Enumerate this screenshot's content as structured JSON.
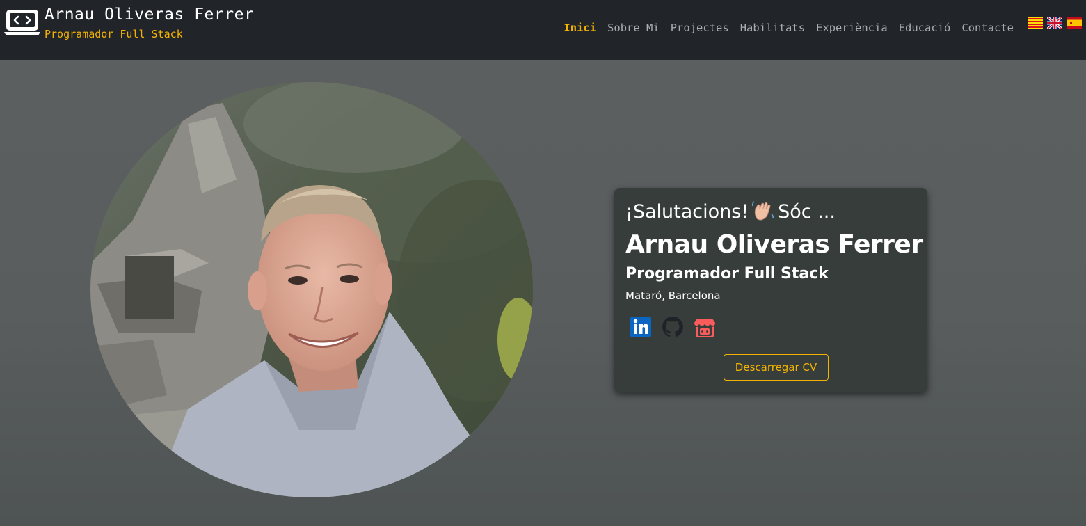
{
  "brand": {
    "name": "Arnau Oliveras Ferrer",
    "role": "Programador Full Stack",
    "logo_icon": "laptop-code-icon"
  },
  "nav": {
    "items": [
      {
        "label": "Inici",
        "active": true
      },
      {
        "label": "Sobre Mi",
        "active": false
      },
      {
        "label": "Projectes",
        "active": false
      },
      {
        "label": "Habilitats",
        "active": false
      },
      {
        "label": "Experiència",
        "active": false
      },
      {
        "label": "Educació",
        "active": false
      },
      {
        "label": "Contacte",
        "active": false
      }
    ],
    "languages": [
      "catalan-flag-icon",
      "uk-flag-icon",
      "spain-flag-icon"
    ]
  },
  "hero": {
    "greeting_prefix": "¡Salutacions!",
    "greeting_suffix": "Sóc ...",
    "wave_icon": "waving-hand-icon",
    "name": "Arnau Oliveras Ferrer",
    "role": "Programador Full Stack",
    "location": "Mataró, Barcelona",
    "socials": [
      "linkedin-icon",
      "github-icon",
      "itchio-icon"
    ],
    "cv_button": "Descarregar CV"
  },
  "colors": {
    "accent": "#f5b301",
    "navbar_bg": "#212529",
    "card_bg": "#373d3b",
    "linkedin": "#0a66c2",
    "itchio": "#fa5c5c"
  }
}
